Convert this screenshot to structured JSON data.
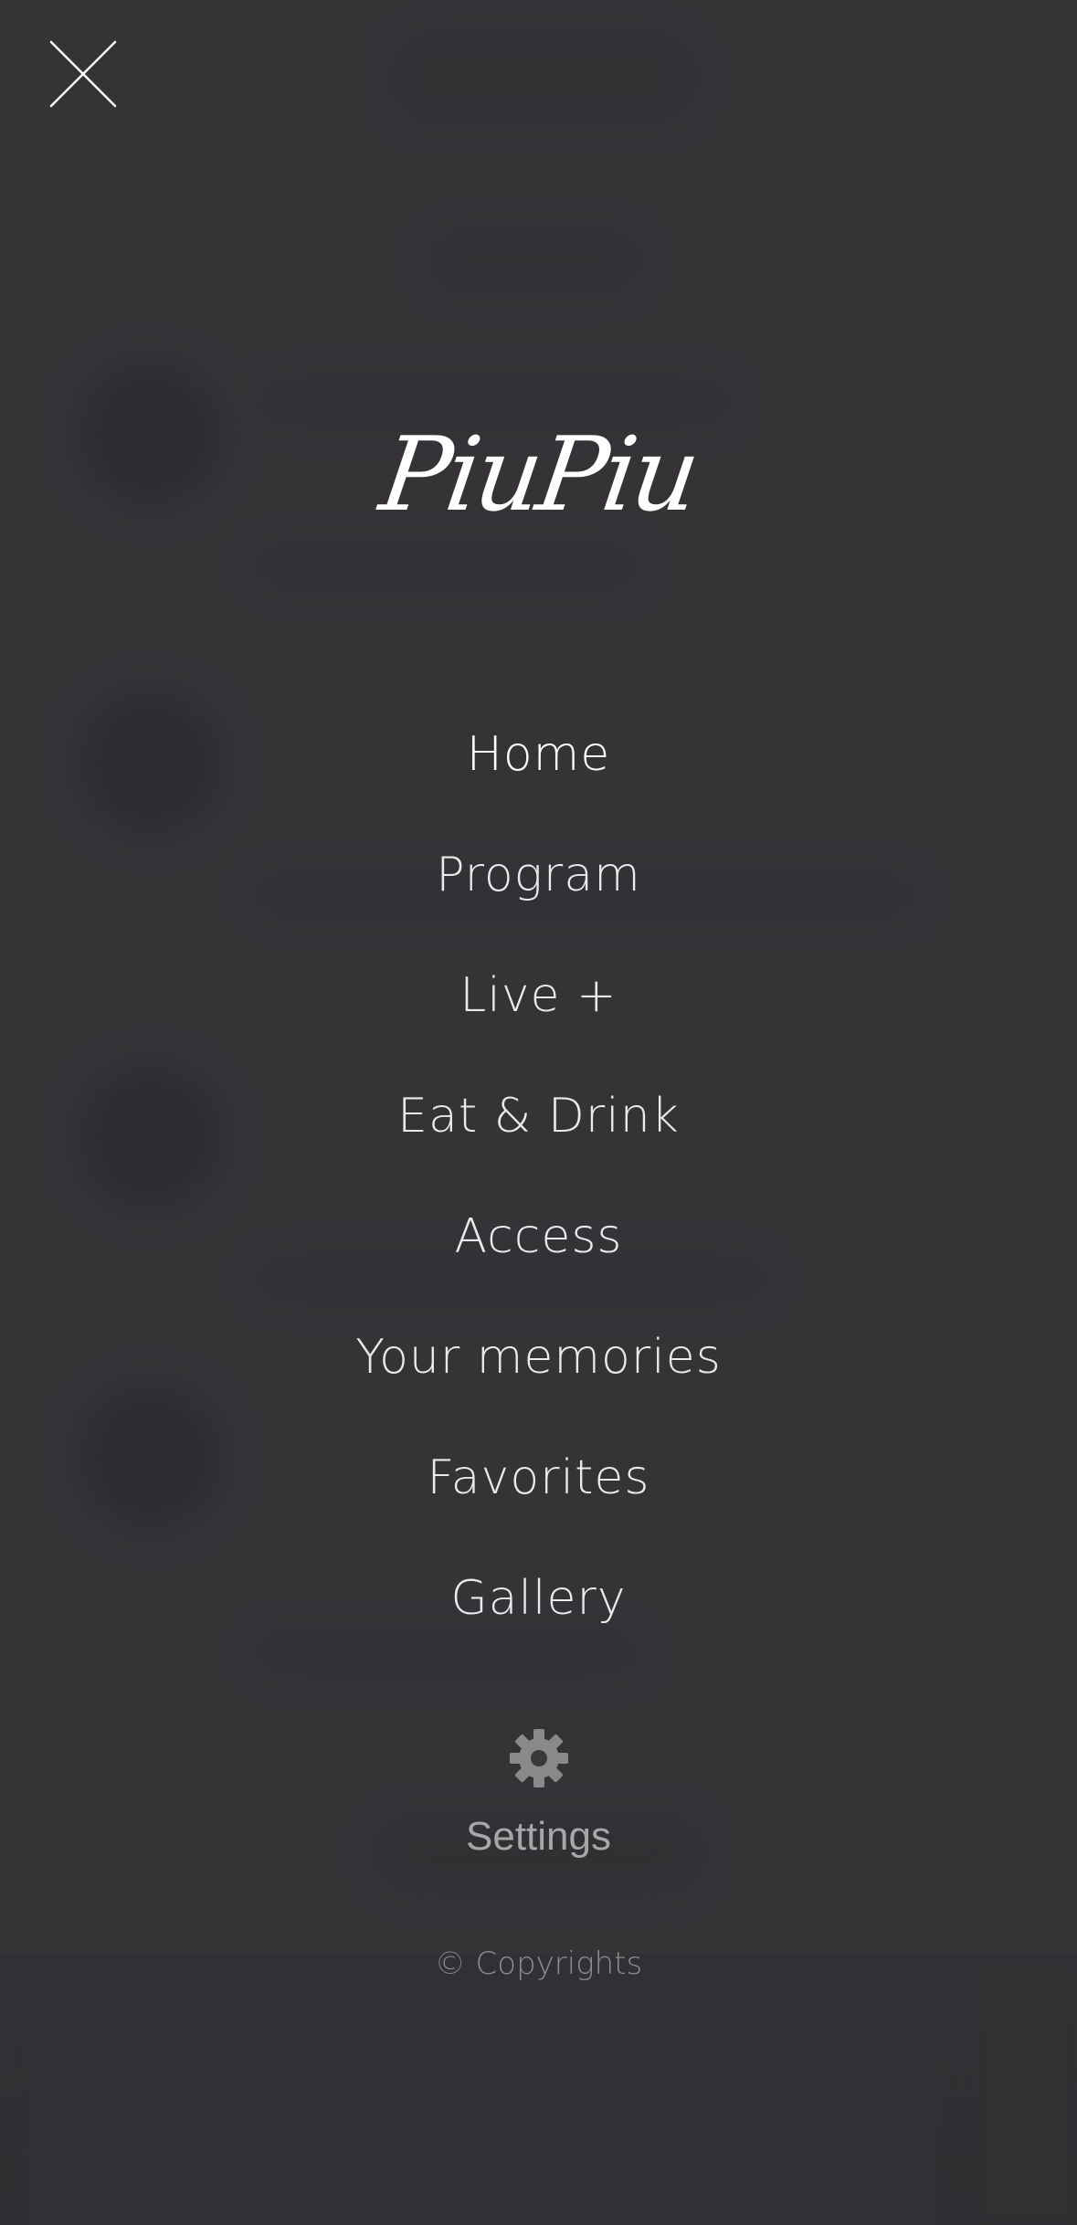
{
  "header": {
    "close_icon": "close-icon"
  },
  "brand": {
    "logo_text": "PiuPiu"
  },
  "menu": {
    "items": [
      {
        "label": "Home"
      },
      {
        "label": "Program"
      },
      {
        "label": "Live +"
      },
      {
        "label": "Eat & Drink"
      },
      {
        "label": "Access"
      },
      {
        "label": "Your memories"
      },
      {
        "label": "Favorites"
      },
      {
        "label": "Gallery"
      }
    ],
    "active_item": "Home"
  },
  "settings": {
    "icon": "gear-icon",
    "label": "Settings"
  },
  "footer": {
    "copyright": "© Copyrights"
  },
  "colors": {
    "background": "#353236",
    "menu_text": "#ece9ec",
    "settings_text": "#a9a6aa",
    "footer_text": "#8f8c90"
  }
}
